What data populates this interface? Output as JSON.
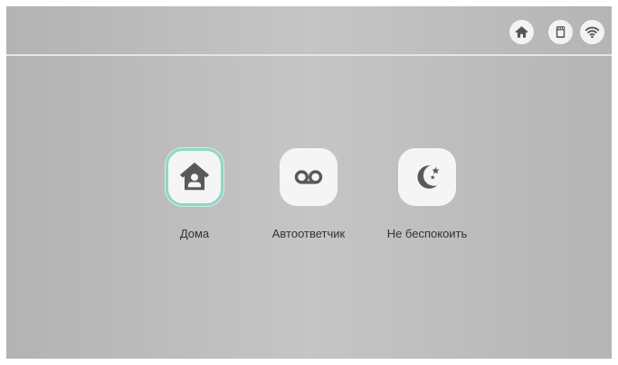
{
  "status_bar": {
    "icons": [
      "home-icon",
      "sd-card-icon",
      "wifi-icon"
    ]
  },
  "modes": [
    {
      "label": "Дома",
      "icon": "home-person-icon",
      "selected": true
    },
    {
      "label": "Автоответчик",
      "icon": "voicemail-icon",
      "selected": false
    },
    {
      "label": "Не беспокоить",
      "icon": "moon-stars-icon",
      "selected": false
    }
  ],
  "colors": {
    "icon_dark": "#595959",
    "tile_bg": "#f5f5f5",
    "selected_border": "#8fd6c6",
    "divider": "#e6e6e6",
    "label_text": "#333333"
  }
}
